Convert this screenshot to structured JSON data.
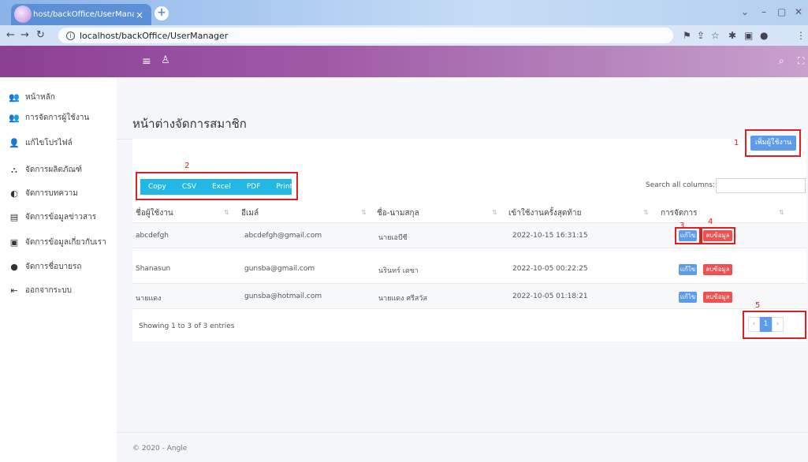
{
  "browser": {
    "tab_title": "host/backOffice/UserManager",
    "tab_close": "×",
    "new_tab": "+",
    "url": "localhost/backOffice/UserManager",
    "info": "i"
  },
  "header": {
    "menu_glyph": "≡",
    "user_glyph": "♙",
    "search_glyph": "⌕",
    "expand_glyph": "⛶"
  },
  "sidebar": {
    "items": [
      {
        "label": "หน้าหลัก",
        "icon": "users-icon",
        "glyph": "👥"
      },
      {
        "label": "การจัดการผู้ใช้งาน",
        "icon": "users-icon",
        "glyph": "👥"
      },
      {
        "label": "แก้ไขโปรไฟล์",
        "icon": "user-edit-icon",
        "glyph": "👤"
      },
      {
        "label": "จัดการผลิตภัณฑ์",
        "icon": "sitemap-icon",
        "glyph": "⛬"
      },
      {
        "label": "จัดการบทความ",
        "icon": "contrast-icon",
        "glyph": "◐"
      },
      {
        "label": "จัดการข้อมูลข่าวสาร",
        "icon": "document-icon",
        "glyph": "▤"
      },
      {
        "label": "จัดการข้อมูลเกี่ยวกับเรา",
        "icon": "info-box-icon",
        "glyph": "▣"
      },
      {
        "label": "จัดการชื่อบายรถ",
        "icon": "circle-icon",
        "glyph": "●"
      },
      {
        "label": "ออกจากระบบ",
        "icon": "logout-icon",
        "glyph": "⇤"
      }
    ]
  },
  "main": {
    "title": "หน้าต่างจัดการสมาชิก",
    "add_user_label": "เพิ่มผู้ใช้งาน",
    "export_buttons": [
      "Copy",
      "CSV",
      "Excel",
      "PDF",
      "Print"
    ],
    "search_label": "Search all columns:",
    "search_value": "",
    "columns": [
      "ชื่อผู้ใช้งาน",
      "อีเมล์",
      "ชื่อ-นามสกุล",
      "เข้าใช้งานครั้งสุดท้าย",
      "การจัดการ"
    ],
    "rows": [
      {
        "username": "abcdefgh",
        "email": "abcdefgh@gmail.com",
        "fullname": "นายเอบีซี",
        "last_login": "2022-10-15 16:31:15"
      },
      {
        "username": "Shanasun",
        "email": "gunsba@gmail.com",
        "fullname": "นรินทร์ เดชา",
        "last_login": "2022-10-05 00:22:25"
      },
      {
        "username": "นายแดง",
        "email": "gunsba@hotmail.com",
        "fullname": "นายแดง ศรีสวัส",
        "last_login": "2022-10-05 01:18:21"
      }
    ],
    "edit_label": "แก้ไข",
    "delete_label": "ลบข้อมูล",
    "info_text": "Showing 1 to 3 of 3 entries",
    "pager": {
      "prev": "‹",
      "current": "1",
      "next": "›"
    }
  },
  "annotations": [
    "1",
    "2",
    "3",
    "4",
    "5"
  ],
  "footer": "© 2020 - Angle",
  "colors": {
    "header_start": "#8b3f95",
    "primary": "#5d9cec",
    "danger": "#f05050",
    "info": "#23b7e5",
    "annotation": "#e02020"
  }
}
